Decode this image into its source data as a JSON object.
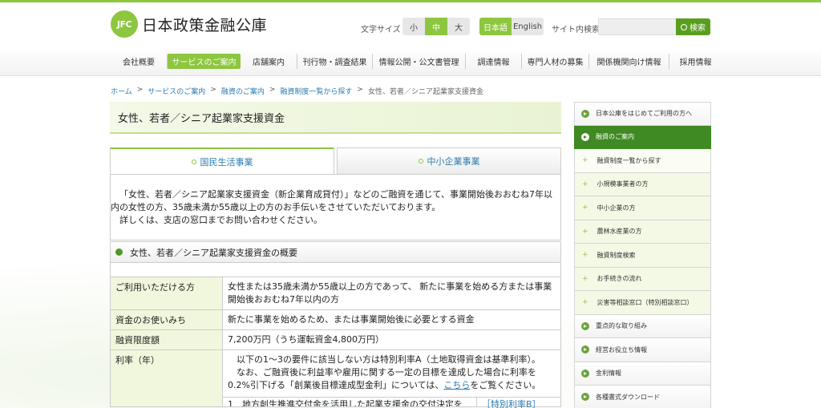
{
  "header": {
    "logo_mark": "JFC",
    "logo_text": "日本政策金融公庫",
    "fontsize_label": "文字サイズ",
    "fontsize_options": [
      "小",
      "中",
      "大"
    ],
    "lang_options": [
      "日本語",
      "English"
    ],
    "search_label": "サイト内検索",
    "search_value": "",
    "search_button": "検索"
  },
  "nav": {
    "items": [
      "会社概要",
      "サービスのご案内",
      "店舗案内",
      "刊行物・調査結果",
      "情報公開・公文書管理",
      "調達情報",
      "専門人材の募集",
      "関係機関向け情報",
      "採用情報"
    ]
  },
  "breadcrumb": [
    "ホーム",
    "サービスのご案内",
    "融資のご案内",
    "融資制度一覧から探す",
    "女性、若者／シニア起業家支援資金"
  ],
  "main": {
    "title": "女性、若者／シニア起業家支援資金",
    "tabs": [
      "国民生活事業",
      "中小企業事業"
    ],
    "intro_line1": "「女性、若者／シニア起業家支援資金（新企業育成貸付）」などのご融資を通じて、事業開始後おおむね7年以内の女性の方、35歳未満か55歳以上の方のお手伝いをさせていただいております。",
    "intro_line2": "詳しくは、支店の窓口までお問い合わせください。",
    "section_title": "女性、若者／シニア起業家支援資金の概要",
    "rows": [
      {
        "label": "ご利用いただける方",
        "value": "女性または35歳未満か55歳以上の方であって、 新たに事業を始める方または事業開始後おおむね7年以内の方"
      },
      {
        "label": "資金のお使いみち",
        "value": "新たに事業を始めるため、または事業開始後に必要とする資金"
      },
      {
        "label": "融資限度額",
        "value": "7,200万円（うち運転資金4,800万円）"
      },
      {
        "label": "利率（年）",
        "value1": "以下の1〜3の要件に該当しない方は特別利率A（土地取得資金は基準利率）。",
        "value2": "なお、ご融資後に利益率や雇用に関する一定の目標を達成した場合に利率を0.2%引下げる「創業後目標達成型金利」については、",
        "link": "こちら",
        "value3": "をご覧ください。",
        "sub_item": "1　地方創生推進交付金を活用した起業支援金の交付決定を",
        "sub_link": "［特別利率B］"
      }
    ]
  },
  "sidebar": {
    "items": [
      "日本公庫をはじめてご利用の方へ",
      "融資のご案内",
      "融資制度一覧から探す",
      "小規模事業者の方",
      "中小企業の方",
      "農林水産業の方",
      "融資制度検索",
      "お手続きの流れ",
      "災害等相談窓口（特別相談窓口）",
      "重点的な取り組み",
      "経営お役立ち情報",
      "金利情報",
      "各種書式ダウンロード"
    ]
  }
}
